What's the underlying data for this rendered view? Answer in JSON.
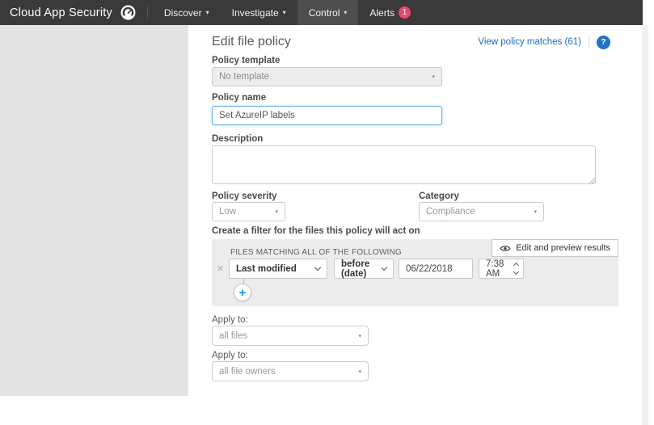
{
  "colors": {
    "topbar_bg": "#3a3a3a",
    "topbar_active_bg": "#4e4e4e",
    "alert_badge": "#e8486b",
    "link_blue": "#1b6ec2",
    "help_blue": "#2272c8",
    "left_panel_gray": "#e3e3e3",
    "filter_panel_gray": "#ececec",
    "plus_blue": "#1191d6",
    "focus_border_blue": "#66afe9"
  },
  "icons": {
    "plus": "+",
    "close": "✕",
    "caret_down": "▾",
    "help_glyph": "?",
    "eye": "eye-icon",
    "gauge": "dashboard-gauge-icon"
  },
  "topbar": {
    "app_title": "Cloud App Security",
    "nav": [
      {
        "label": "Discover"
      },
      {
        "label": "Investigate"
      },
      {
        "label": "Control",
        "active": true
      },
      {
        "label": "Alerts",
        "badge": "1"
      }
    ]
  },
  "header": {
    "title": "Edit file policy",
    "view_matches_link": "View policy matches (61)"
  },
  "form": {
    "policy_template": {
      "label": "Policy template",
      "value": "No template",
      "disabled": true
    },
    "policy_name": {
      "label": "Policy name",
      "value": "Set AzureIP labels"
    },
    "description": {
      "label": "Description",
      "value": ""
    },
    "policy_severity": {
      "label": "Policy severity",
      "value": "Low"
    },
    "category": {
      "label": "Category",
      "value": "Compliance"
    },
    "filter_section": {
      "label": "Create a filter for the files this policy will act on",
      "panel_title": "FILES MATCHING ALL OF THE FOLLOWING",
      "edit_preview_button": "Edit and preview results",
      "row": {
        "field": "Last modified",
        "operator": "before (date)",
        "date_value": "06/22/2018",
        "time_value": "7:38 AM"
      }
    },
    "apply_to_files": {
      "label": "Apply to:",
      "value": "all files"
    },
    "apply_to_owners": {
      "label": "Apply to:",
      "value": "all file owners"
    }
  }
}
